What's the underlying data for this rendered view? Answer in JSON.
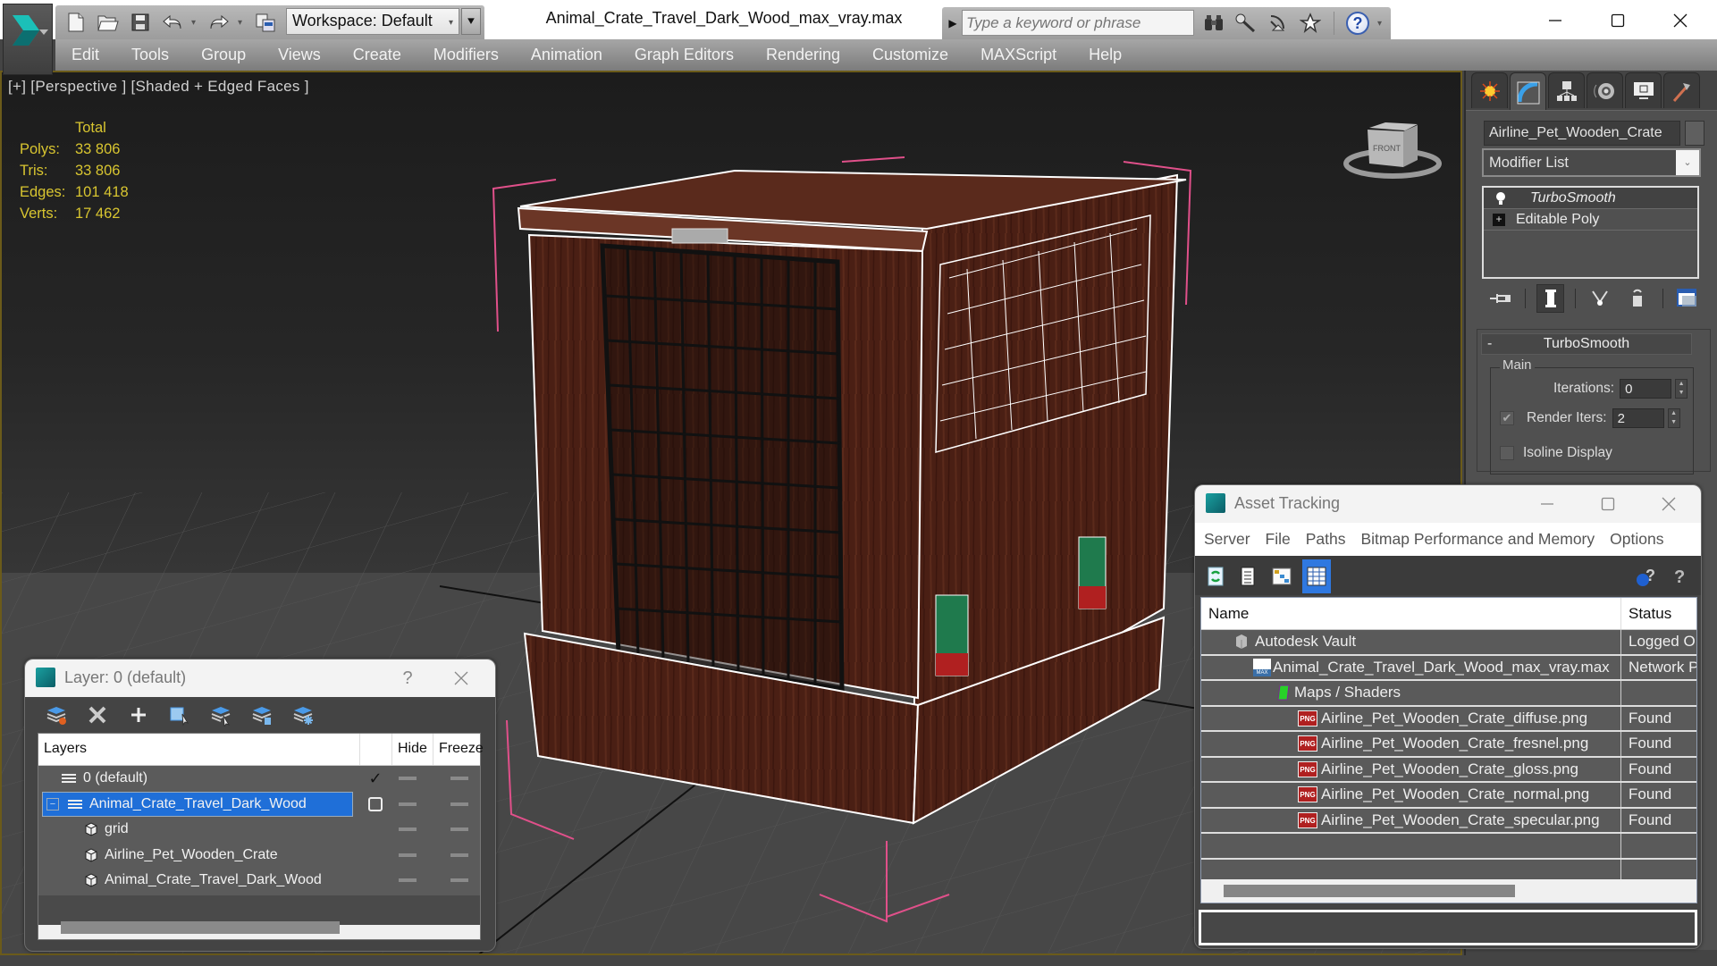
{
  "window": {
    "title": "Animal_Crate_Travel_Dark_Wood_max_vray.max",
    "workspace": "Workspace: Default",
    "search_placeholder": "Type a keyword or phrase",
    "quick_access": [
      "new-icon",
      "open-icon",
      "save-icon",
      "undo-icon",
      "redo-icon",
      "project-icon"
    ],
    "search_tools": [
      "binoculars-icon",
      "key-icon",
      "satellite-icon",
      "star-icon",
      "help-icon"
    ],
    "controls": [
      "minimize",
      "maximize",
      "close"
    ]
  },
  "menu": [
    "Edit",
    "Tools",
    "Group",
    "Views",
    "Create",
    "Modifiers",
    "Animation",
    "Graph Editors",
    "Rendering",
    "Customize",
    "MAXScript",
    "Help"
  ],
  "viewport": {
    "label": "[+] [Perspective ] [Shaded + Edged Faces ]",
    "stats": {
      "header": "Total",
      "rows": [
        {
          "label": "Polys:",
          "value": "33 806"
        },
        {
          "label": "Tris:",
          "value": "33 806"
        },
        {
          "label": "Edges:",
          "value": "101 418"
        },
        {
          "label": "Verts:",
          "value": "17 462"
        }
      ]
    },
    "viewcube_label": "FRONT",
    "colors": {
      "stats": "#d8c530",
      "selection_bracket": "#e0508a",
      "wood": "#4a1f14",
      "wire": "#ffffff"
    }
  },
  "command_panel": {
    "tabs": [
      "create-icon",
      "modify-icon",
      "hierarchy-icon",
      "motion-icon",
      "display-icon",
      "utilities-icon"
    ],
    "active_tab": 1,
    "object_name": "Airline_Pet_Wooden_Crate",
    "modifier_list": "Modifier List",
    "stack": [
      {
        "label": "TurboSmooth",
        "italic": true
      },
      {
        "label": "Editable Poly",
        "italic": false
      }
    ],
    "rollout": {
      "title": "TurboSmooth",
      "collapse": "-",
      "group": "Main",
      "iterations_label": "Iterations:",
      "iterations": "0",
      "render_iters_label": "Render Iters:",
      "render_iters": "2",
      "render_iters_checked": true,
      "isoline_label": "Isoline Display",
      "isoline_checked": false
    }
  },
  "layer_dialog": {
    "title": "Layer: 0 (default)",
    "help": "?",
    "toolbar": [
      "new-layer-icon",
      "delete-layer-icon",
      "add-to-layer-icon",
      "select-objects-icon",
      "select-layer-icon",
      "highlight-layer-icon",
      "freeze-layer-icon"
    ],
    "columns": {
      "layers": "Layers",
      "hide": "Hide",
      "freeze": "Freeze"
    },
    "rows": [
      {
        "name": "0 (default)",
        "type": "layer",
        "indent": 0,
        "current": true
      },
      {
        "name": "Animal_Crate_Travel_Dark_Wood",
        "type": "layer",
        "indent": 0,
        "selected": true,
        "expanded": true
      },
      {
        "name": "grid",
        "type": "object",
        "indent": 1
      },
      {
        "name": "Airline_Pet_Wooden_Crate",
        "type": "object",
        "indent": 1
      },
      {
        "name": "Animal_Crate_Travel_Dark_Wood",
        "type": "object",
        "indent": 1
      }
    ]
  },
  "asset_dialog": {
    "title": "Asset Tracking",
    "menu": [
      "Server",
      "File",
      "Paths",
      "Bitmap Performance and Memory",
      "Options"
    ],
    "toolbar": [
      "refresh-icon",
      "list-icon",
      "tree-icon",
      "table-icon",
      "vault-help-icon",
      "help-icon"
    ],
    "active_tool": 3,
    "columns": {
      "name": "Name",
      "status": "Status"
    },
    "rows": [
      {
        "name": "Autodesk Vault",
        "status": "Logged O",
        "icon": "vault-icon",
        "indent": 1
      },
      {
        "name": "Animal_Crate_Travel_Dark_Wood_max_vray.max",
        "status": "Network P",
        "icon": "max-file-icon",
        "indent": 2
      },
      {
        "name": "Maps / Shaders",
        "status": "",
        "icon": "maps-icon",
        "indent": 3
      },
      {
        "name": "Airline_Pet_Wooden_Crate_diffuse.png",
        "status": "Found",
        "icon": "png-icon",
        "indent": 4
      },
      {
        "name": "Airline_Pet_Wooden_Crate_fresnel.png",
        "status": "Found",
        "icon": "png-icon",
        "indent": 4
      },
      {
        "name": "Airline_Pet_Wooden_Crate_gloss.png",
        "status": "Found",
        "icon": "png-icon",
        "indent": 4
      },
      {
        "name": "Airline_Pet_Wooden_Crate_normal.png",
        "status": "Found",
        "icon": "png-icon",
        "indent": 4
      },
      {
        "name": "Airline_Pet_Wooden_Crate_specular.png",
        "status": "Found",
        "icon": "png-icon",
        "indent": 4
      },
      {
        "name": "",
        "status": "",
        "icon": "",
        "indent": 0
      },
      {
        "name": "",
        "status": "",
        "icon": "",
        "indent": 0
      }
    ],
    "png_label": "PNG",
    "max_label": "MAX"
  }
}
